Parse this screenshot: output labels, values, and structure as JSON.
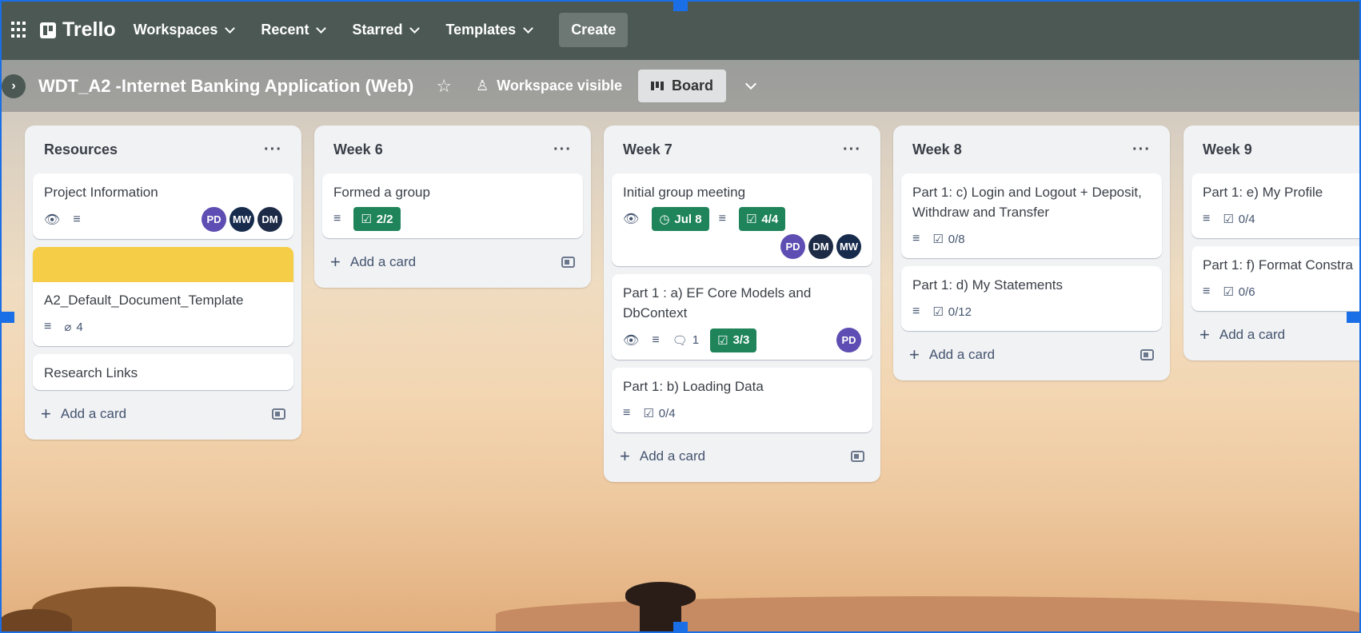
{
  "topbar": {
    "logo_text": "Trello",
    "nav": [
      {
        "label": "Workspaces"
      },
      {
        "label": "Recent"
      },
      {
        "label": "Starred"
      },
      {
        "label": "Templates"
      }
    ],
    "create_label": "Create"
  },
  "board": {
    "title": "WDT_A2 -Internet Banking Application (Web)",
    "visibility": "Workspace visible",
    "view_label": "Board"
  },
  "lists": [
    {
      "title": "Resources",
      "add_label": "Add a card",
      "cards": [
        {
          "title": "Project Information",
          "members": [
            "PD",
            "MW",
            "DM"
          ]
        },
        {
          "title": "A2_Default_Document_Template",
          "attachments": "4",
          "cover": "#f5cd47"
        },
        {
          "title": "Research Links"
        }
      ]
    },
    {
      "title": "Week 6",
      "add_label": "Add a card",
      "cards": [
        {
          "title": "Formed a group",
          "checklist": "2/2"
        }
      ]
    },
    {
      "title": "Week 7",
      "add_label": "Add a card",
      "cards": [
        {
          "title": "Initial group meeting",
          "due": "Jul 8",
          "checklist": "4/4",
          "members": [
            "PD",
            "DM",
            "MW"
          ]
        },
        {
          "title": "Part 1 : a) EF Core Models and DbContext",
          "comments": "1",
          "checklist": "3/3",
          "members": [
            "PD"
          ]
        },
        {
          "title": "Part 1: b) Loading Data",
          "checklist": "0/4"
        }
      ]
    },
    {
      "title": "Week 8",
      "add_label": "Add a card",
      "cards": [
        {
          "title": "Part 1: c) Login and Logout + Deposit, Withdraw and Transfer",
          "checklist": "0/8"
        },
        {
          "title": "Part 1: d) My Statements",
          "checklist": "0/12"
        }
      ]
    },
    {
      "title": "Week 9",
      "add_label": "Add a card",
      "cards": [
        {
          "title": "Part 1: e) My Profile",
          "checklist": "0/4"
        },
        {
          "title": "Part 1: f) Format Constra",
          "checklist": "0/6"
        }
      ]
    }
  ],
  "colors": {
    "topbar": "#4b5854",
    "badge_green": "#1f845a",
    "avatar_purple": "#5e4db2",
    "avatar_navy": "#172b4d",
    "selection": "#1a6ee6"
  }
}
